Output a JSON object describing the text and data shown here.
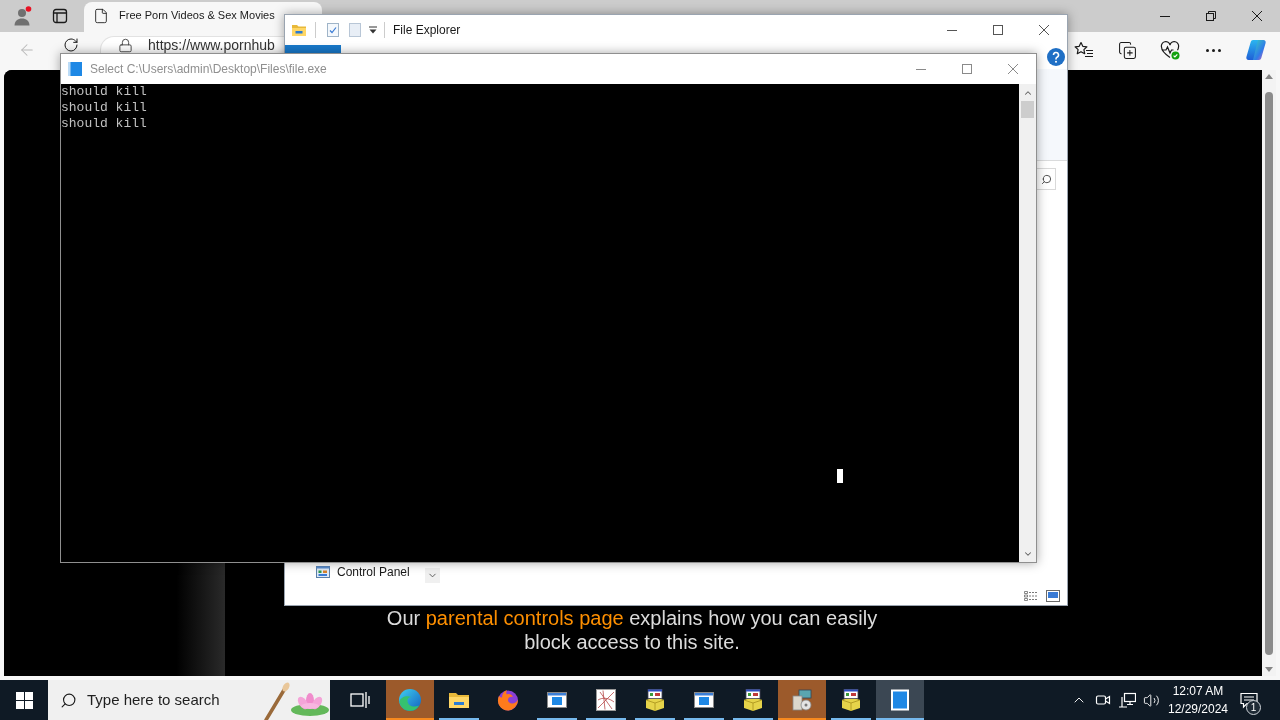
{
  "browser": {
    "tab": {
      "title": "Free Porn Videos & Sex Movies"
    },
    "back": {
      "disabled": true
    },
    "address": "https://www.pornhub",
    "page": {
      "notice_start": "Our",
      "notice_link": "parental controls page",
      "notice_end": "explains how you can easily block access to this site."
    }
  },
  "file_explorer": {
    "title": "File Explorer",
    "navigation_item": "Control Panel"
  },
  "console": {
    "title": "Select C:\\Users\\admin\\Desktop\\Files\\file.exe",
    "lines": [
      "should kill",
      "should kill",
      "should kill"
    ]
  },
  "taskbar": {
    "search": {
      "placeholder": "Type here to search"
    },
    "apps": [
      {
        "kind": "swirl",
        "running": true,
        "flashing": true,
        "selected": false
      },
      {
        "kind": "folder",
        "running": true,
        "flashing": false,
        "selected": false
      },
      {
        "kind": "fox",
        "running": false,
        "flashing": false,
        "selected": false
      },
      {
        "kind": "window",
        "running": true,
        "flashing": false,
        "selected": false
      },
      {
        "kind": "sketch",
        "running": true,
        "flashing": false,
        "selected": false
      },
      {
        "kind": "installer",
        "running": true,
        "flashing": false,
        "selected": false
      },
      {
        "kind": "window",
        "running": true,
        "flashing": false,
        "selected": false
      },
      {
        "kind": "installer",
        "running": true,
        "flashing": false,
        "selected": false
      },
      {
        "kind": "setup",
        "running": true,
        "flashing": true,
        "selected": false
      },
      {
        "kind": "installer",
        "running": true,
        "flashing": false,
        "selected": false
      },
      {
        "kind": "panel",
        "running": true,
        "flashing": false,
        "selected": true
      }
    ],
    "clock": {
      "time": "12:07 AM",
      "date": "12/29/2024"
    },
    "notifications": {
      "count": "1"
    }
  }
}
